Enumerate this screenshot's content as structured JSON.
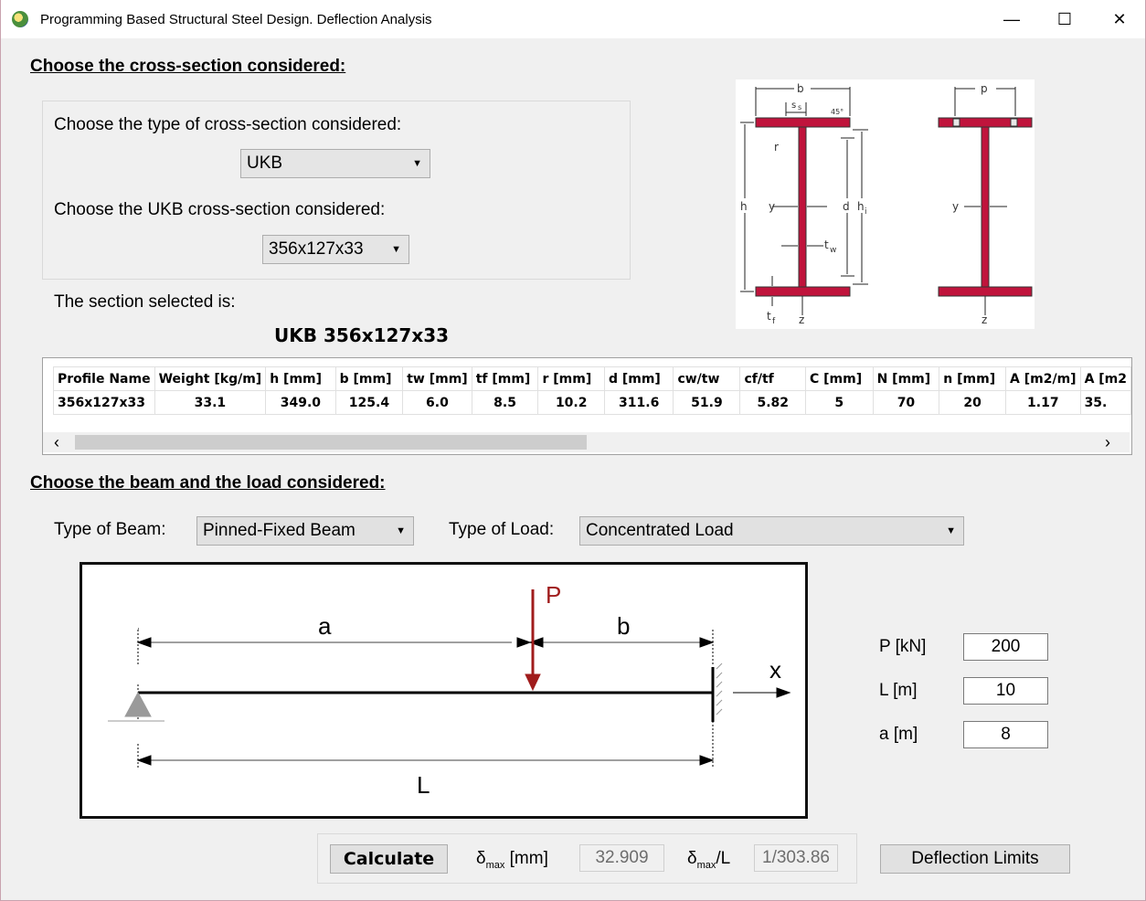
{
  "window": {
    "title": "Programming Based Structural Steel Design. Deflection Analysis",
    "minimize_glyph": "—",
    "maximize_glyph": "☐",
    "close_glyph": "✕"
  },
  "section": {
    "heading": "Choose the cross-section considered:",
    "type_label": "Choose the type of cross-section considered:",
    "type_value": "UKB",
    "sub_label": "Choose the UKB cross-section considered:",
    "sub_value": "356x127x33",
    "selected_label": "The section selected is:",
    "selected_value": "UKB 356x127x33"
  },
  "figure": {
    "labels": [
      "b",
      "s",
      "s",
      "45°",
      "r",
      "h",
      "y",
      "d",
      "h",
      "i",
      "t",
      "w",
      "t",
      "f",
      "z",
      "p",
      "y",
      "z"
    ]
  },
  "table": {
    "headers": [
      "Profile Name",
      "Weight [kg/m]",
      "h [mm]",
      "b [mm]",
      "tw [mm]",
      "tf [mm]",
      "r [mm]",
      "d [mm]",
      "cw/tw",
      "cf/tf",
      "C [mm]",
      "N [mm]",
      "n [mm]",
      "A [m2/m]",
      "A [m2"
    ],
    "rows": [
      [
        "356x127x33",
        "33.1",
        "349.0",
        "125.4",
        "6.0",
        "8.5",
        "10.2",
        "311.6",
        "51.9",
        "5.82",
        "5",
        "70",
        "20",
        "1.17",
        "35."
      ]
    ],
    "scroll_left": "‹",
    "scroll_right": "›"
  },
  "beam": {
    "heading": "Choose the beam and the load considered:",
    "beam_type_label": "Type of Beam:",
    "beam_type_value": "Pinned-Fixed Beam",
    "load_type_label": "Type of Load:",
    "load_type_value": "Concentrated Load",
    "diagram": {
      "P": "P",
      "a": "a",
      "b": "b",
      "L": "L",
      "x": "x"
    }
  },
  "inputs": {
    "P_label": "P [kN]",
    "P_value": "200",
    "L_label": "L [m]",
    "L_value": "10",
    "a_label": "a [m]",
    "a_value": "8"
  },
  "results": {
    "calculate_label": "Calculate",
    "dmax_symbol": "δ",
    "dmax_sub": "max",
    "dmax_unit": " [mm]",
    "dmax_value": "32.909",
    "ratio_symbol": "δ",
    "ratio_sub": "max",
    "ratio_suffix": "/L",
    "ratio_value": "1/303.86",
    "limits_label": "Deflection Limits"
  },
  "colors": {
    "steel": "#c0143c",
    "load_arrow": "#a01c1c"
  }
}
